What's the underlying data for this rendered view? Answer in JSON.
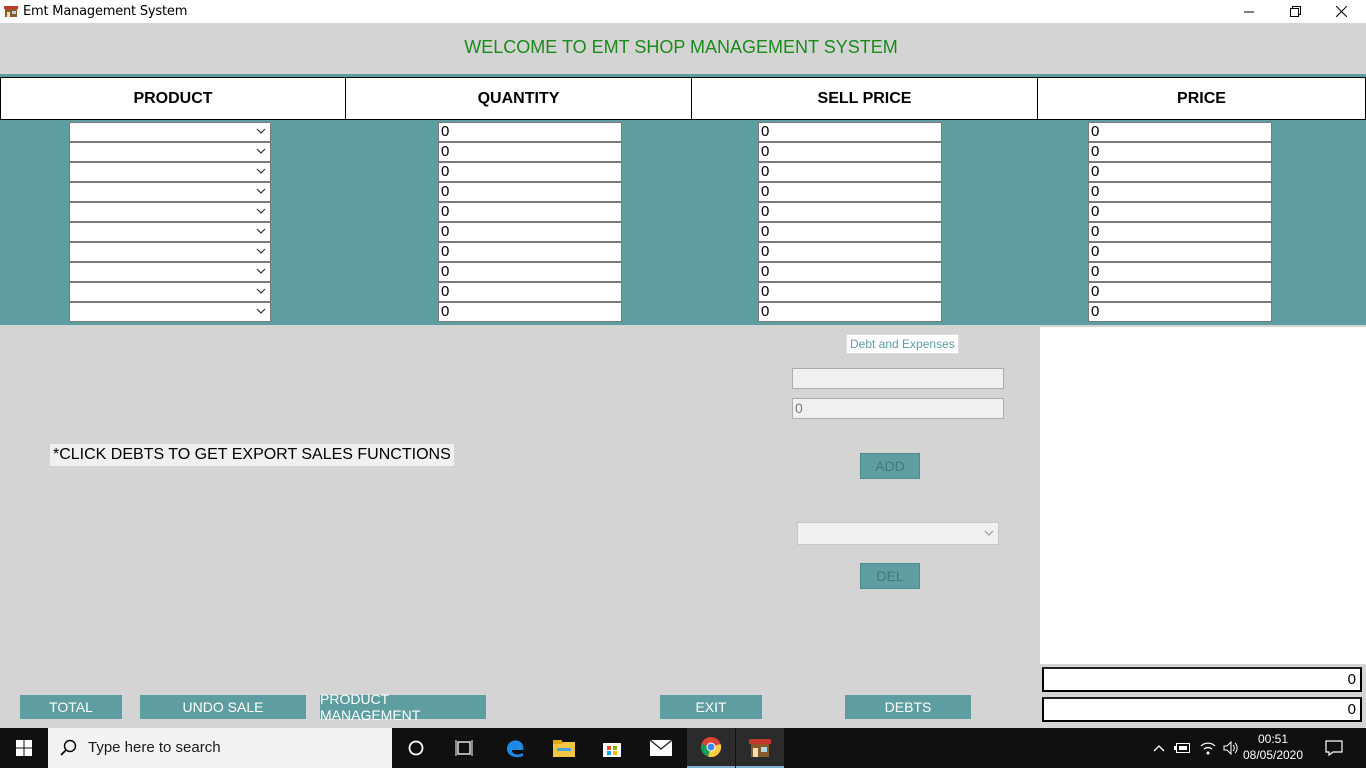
{
  "window": {
    "title": "Emt Management System",
    "controls": [
      "minimize-icon",
      "restore-icon",
      "close-icon"
    ]
  },
  "header": {
    "welcome": "WELCOME TO EMT SHOP MANAGEMENT SYSTEM"
  },
  "columns": [
    "PRODUCT",
    "QUANTITY",
    "SELL PRICE",
    "PRICE"
  ],
  "rows": [
    {
      "product": "",
      "quantity": "0",
      "sell_price": "0",
      "price": "0"
    },
    {
      "product": "",
      "quantity": "0",
      "sell_price": "0",
      "price": "0"
    },
    {
      "product": "",
      "quantity": "0",
      "sell_price": "0",
      "price": "0"
    },
    {
      "product": "",
      "quantity": "0",
      "sell_price": "0",
      "price": "0"
    },
    {
      "product": "",
      "quantity": "0",
      "sell_price": "0",
      "price": "0"
    },
    {
      "product": "",
      "quantity": "0",
      "sell_price": "0",
      "price": "0"
    },
    {
      "product": "",
      "quantity": "0",
      "sell_price": "0",
      "price": "0"
    },
    {
      "product": "",
      "quantity": "0",
      "sell_price": "0",
      "price": "0"
    },
    {
      "product": "",
      "quantity": "0",
      "sell_price": "0",
      "price": "0"
    },
    {
      "product": "",
      "quantity": "0",
      "sell_price": "0",
      "price": "0"
    }
  ],
  "debt_panel": {
    "label": "Debt and Expenses",
    "name_value": "",
    "amount_value": "0",
    "add_label": "ADD",
    "select_value": "",
    "del_label": "DEL"
  },
  "notice": "*CLICK DEBTS TO GET EXPORT SALES FUNCTIONS",
  "buttons": {
    "total": "TOTAL",
    "undo_sale": "UNDO SALE",
    "product_management": "PRODUCT MANAGEMENT",
    "exit": "EXIT",
    "debts": "DEBTS"
  },
  "totals": {
    "box1": "0",
    "box2": "0"
  },
  "taskbar": {
    "search_placeholder": "Type here to search",
    "time": "00:51",
    "date": "08/05/2020",
    "pinned": [
      "cortana-icon",
      "task-view-icon",
      "edge-icon",
      "file-explorer-icon",
      "store-icon",
      "mail-icon",
      "chrome-icon",
      "emt-app-icon"
    ]
  },
  "colors": {
    "teal": "#5f9ea0",
    "welcome_green": "#1b8a1b",
    "panel_gray": "#d4d4d4"
  }
}
